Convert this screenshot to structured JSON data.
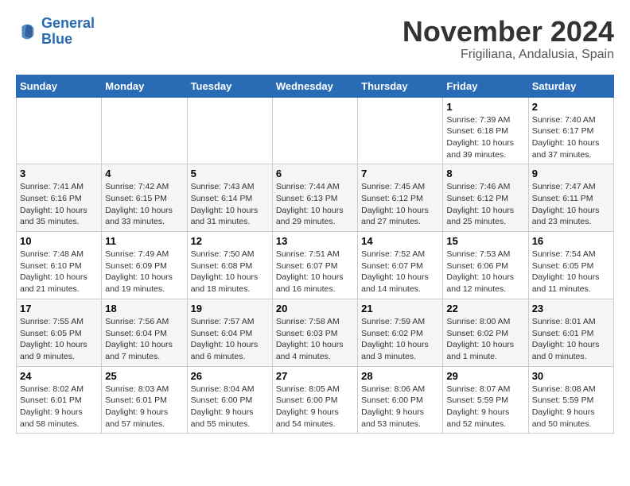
{
  "header": {
    "logo_line1": "General",
    "logo_line2": "Blue",
    "month": "November 2024",
    "location": "Frigiliana, Andalusia, Spain"
  },
  "weekdays": [
    "Sunday",
    "Monday",
    "Tuesday",
    "Wednesday",
    "Thursday",
    "Friday",
    "Saturday"
  ],
  "weeks": [
    [
      {
        "day": "",
        "info": ""
      },
      {
        "day": "",
        "info": ""
      },
      {
        "day": "",
        "info": ""
      },
      {
        "day": "",
        "info": ""
      },
      {
        "day": "",
        "info": ""
      },
      {
        "day": "1",
        "info": "Sunrise: 7:39 AM\nSunset: 6:18 PM\nDaylight: 10 hours and 39 minutes."
      },
      {
        "day": "2",
        "info": "Sunrise: 7:40 AM\nSunset: 6:17 PM\nDaylight: 10 hours and 37 minutes."
      }
    ],
    [
      {
        "day": "3",
        "info": "Sunrise: 7:41 AM\nSunset: 6:16 PM\nDaylight: 10 hours and 35 minutes."
      },
      {
        "day": "4",
        "info": "Sunrise: 7:42 AM\nSunset: 6:15 PM\nDaylight: 10 hours and 33 minutes."
      },
      {
        "day": "5",
        "info": "Sunrise: 7:43 AM\nSunset: 6:14 PM\nDaylight: 10 hours and 31 minutes."
      },
      {
        "day": "6",
        "info": "Sunrise: 7:44 AM\nSunset: 6:13 PM\nDaylight: 10 hours and 29 minutes."
      },
      {
        "day": "7",
        "info": "Sunrise: 7:45 AM\nSunset: 6:12 PM\nDaylight: 10 hours and 27 minutes."
      },
      {
        "day": "8",
        "info": "Sunrise: 7:46 AM\nSunset: 6:12 PM\nDaylight: 10 hours and 25 minutes."
      },
      {
        "day": "9",
        "info": "Sunrise: 7:47 AM\nSunset: 6:11 PM\nDaylight: 10 hours and 23 minutes."
      }
    ],
    [
      {
        "day": "10",
        "info": "Sunrise: 7:48 AM\nSunset: 6:10 PM\nDaylight: 10 hours and 21 minutes."
      },
      {
        "day": "11",
        "info": "Sunrise: 7:49 AM\nSunset: 6:09 PM\nDaylight: 10 hours and 19 minutes."
      },
      {
        "day": "12",
        "info": "Sunrise: 7:50 AM\nSunset: 6:08 PM\nDaylight: 10 hours and 18 minutes."
      },
      {
        "day": "13",
        "info": "Sunrise: 7:51 AM\nSunset: 6:07 PM\nDaylight: 10 hours and 16 minutes."
      },
      {
        "day": "14",
        "info": "Sunrise: 7:52 AM\nSunset: 6:07 PM\nDaylight: 10 hours and 14 minutes."
      },
      {
        "day": "15",
        "info": "Sunrise: 7:53 AM\nSunset: 6:06 PM\nDaylight: 10 hours and 12 minutes."
      },
      {
        "day": "16",
        "info": "Sunrise: 7:54 AM\nSunset: 6:05 PM\nDaylight: 10 hours and 11 minutes."
      }
    ],
    [
      {
        "day": "17",
        "info": "Sunrise: 7:55 AM\nSunset: 6:05 PM\nDaylight: 10 hours and 9 minutes."
      },
      {
        "day": "18",
        "info": "Sunrise: 7:56 AM\nSunset: 6:04 PM\nDaylight: 10 hours and 7 minutes."
      },
      {
        "day": "19",
        "info": "Sunrise: 7:57 AM\nSunset: 6:04 PM\nDaylight: 10 hours and 6 minutes."
      },
      {
        "day": "20",
        "info": "Sunrise: 7:58 AM\nSunset: 6:03 PM\nDaylight: 10 hours and 4 minutes."
      },
      {
        "day": "21",
        "info": "Sunrise: 7:59 AM\nSunset: 6:02 PM\nDaylight: 10 hours and 3 minutes."
      },
      {
        "day": "22",
        "info": "Sunrise: 8:00 AM\nSunset: 6:02 PM\nDaylight: 10 hours and 1 minute."
      },
      {
        "day": "23",
        "info": "Sunrise: 8:01 AM\nSunset: 6:01 PM\nDaylight: 10 hours and 0 minutes."
      }
    ],
    [
      {
        "day": "24",
        "info": "Sunrise: 8:02 AM\nSunset: 6:01 PM\nDaylight: 9 hours and 58 minutes."
      },
      {
        "day": "25",
        "info": "Sunrise: 8:03 AM\nSunset: 6:01 PM\nDaylight: 9 hours and 57 minutes."
      },
      {
        "day": "26",
        "info": "Sunrise: 8:04 AM\nSunset: 6:00 PM\nDaylight: 9 hours and 55 minutes."
      },
      {
        "day": "27",
        "info": "Sunrise: 8:05 AM\nSunset: 6:00 PM\nDaylight: 9 hours and 54 minutes."
      },
      {
        "day": "28",
        "info": "Sunrise: 8:06 AM\nSunset: 6:00 PM\nDaylight: 9 hours and 53 minutes."
      },
      {
        "day": "29",
        "info": "Sunrise: 8:07 AM\nSunset: 5:59 PM\nDaylight: 9 hours and 52 minutes."
      },
      {
        "day": "30",
        "info": "Sunrise: 8:08 AM\nSunset: 5:59 PM\nDaylight: 9 hours and 50 minutes."
      }
    ]
  ]
}
